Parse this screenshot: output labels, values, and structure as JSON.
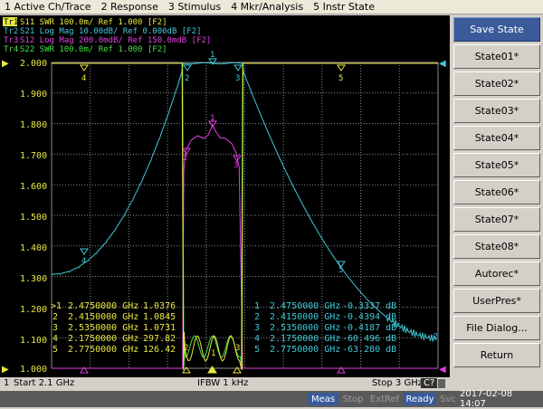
{
  "menu": [
    "1 Active Ch/Trace",
    "2 Response",
    "3 Stimulus",
    "4 Mkr/Analysis",
    "5 Instr State"
  ],
  "traces": [
    {
      "id": "Tr1",
      "label": "S11  SWR 100.0m/ Ref 1.000  [F2]",
      "color": "#e8e840",
      "active": true
    },
    {
      "id": "Tr2",
      "label": "S21  Log Mag 10.00dB/ Ref 0.000dB  [F2]",
      "color": "#40c8d8",
      "active": false
    },
    {
      "id": "Tr3",
      "label": "S12  Log Mag 200.0mdB/ Ref 150.0mdB  [F2]",
      "color": "#e040e0",
      "active": false
    },
    {
      "id": "Tr4",
      "label": "S22  SWR 100.0m/ Ref 1.000  [F2]",
      "color": "#40e040",
      "active": false
    }
  ],
  "y_axis_labels": [
    "2.000",
    "1.900",
    "1.800",
    "1.700",
    "1.600",
    "1.500",
    "1.400",
    "1.300",
    "1.200",
    "1.100",
    "1.000"
  ],
  "marker_table_s11": {
    "color": "#e8e840",
    "rows": [
      {
        "n": ">1",
        "freq": "2.4750000 GHz",
        "val": "1.0376"
      },
      {
        "n": "2",
        "freq": "2.4150000 GHz",
        "val": "1.0845"
      },
      {
        "n": "3",
        "freq": "2.5350000 GHz",
        "val": "1.0731"
      },
      {
        "n": "4",
        "freq": "2.1750000 GHz",
        "val": "297.82"
      },
      {
        "n": "5",
        "freq": "2.7750000 GHz",
        "val": "126.42"
      }
    ]
  },
  "marker_table_s21": {
    "color": "#40c8d8",
    "rows": [
      {
        "n": "1",
        "freq": "2.4750000 GHz",
        "val": "-0.3337 dB"
      },
      {
        "n": "2",
        "freq": "2.4150000 GHz",
        "val": "-0.4394 dB"
      },
      {
        "n": "3",
        "freq": "2.5350000 GHz",
        "val": "-0.4187 dB"
      },
      {
        "n": "4",
        "freq": "2.1750000 GHz",
        "val": "-60.496 dB"
      },
      {
        "n": "5",
        "freq": "2.7750000 GHz",
        "val": "-63.280 dB"
      }
    ]
  },
  "marker_labels": [
    "1",
    "2",
    "3",
    "4",
    "5"
  ],
  "ref_marker_left": "▶",
  "ref_marker_right": "◀",
  "softkeys": [
    "Save State",
    "State01*",
    "State02*",
    "State03*",
    "State04*",
    "State05*",
    "State06*",
    "State07*",
    "State08*",
    "Autorec*",
    "UserPres*",
    "File Dialog...",
    "Return"
  ],
  "infobar": {
    "channel": "1",
    "start": "Start 2.1 GHz",
    "ifbw": "IFBW 1 kHz",
    "stop": "Stop 3 GHz",
    "cal": "C?"
  },
  "status": {
    "meas": "Meas",
    "stop": "Stop",
    "extref": "ExtRef",
    "ready": "Ready",
    "svc": "Svc",
    "datetime": "2017-02-08 14:07"
  }
}
